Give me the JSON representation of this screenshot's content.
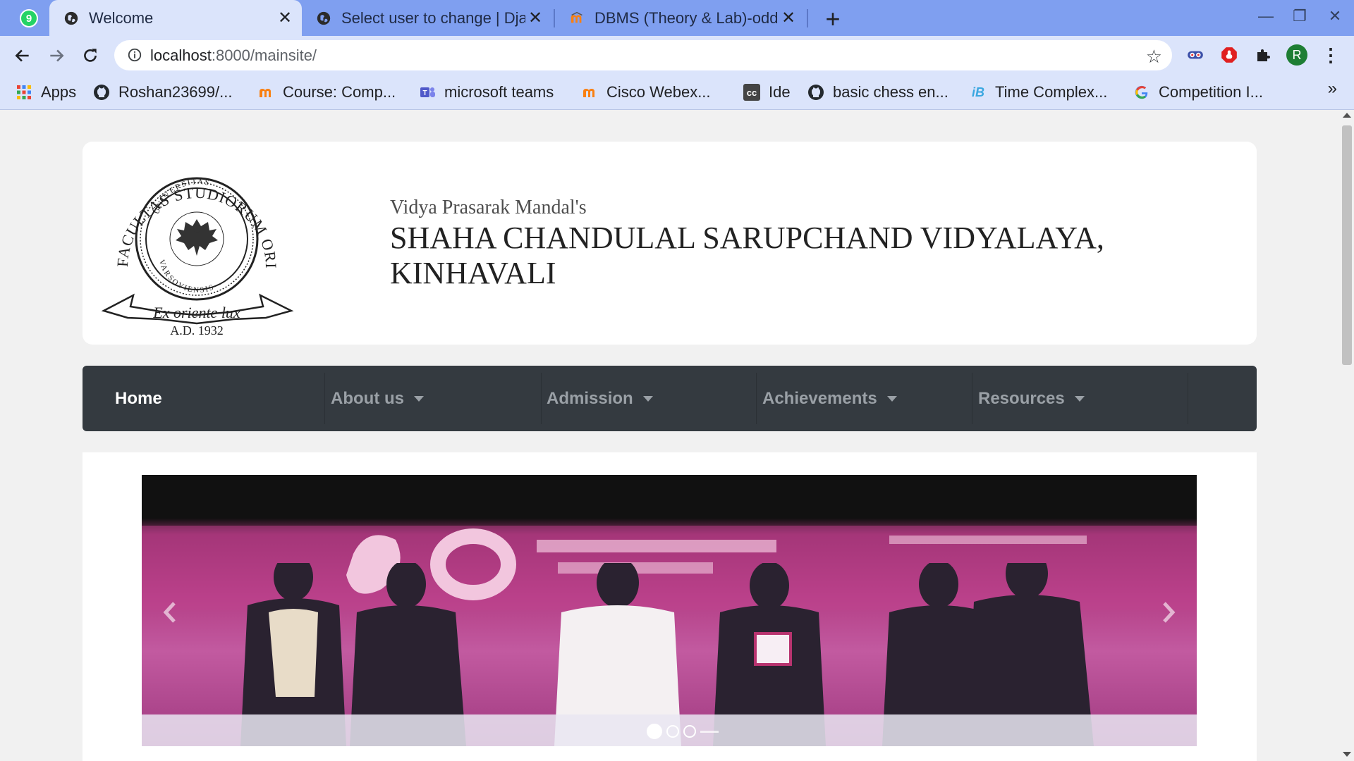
{
  "browser": {
    "tabs": [
      {
        "title": "Welcome",
        "active": true
      },
      {
        "title": "Select user to change | Dja",
        "active": false
      },
      {
        "title": "DBMS (Theory & Lab)-odd",
        "active": false
      }
    ],
    "whatsapp_badge": "9",
    "url_host": "localhost",
    "url_rest": ":8000/mainsite/",
    "profile_initial": "R",
    "bookmarks": [
      {
        "label": "Apps",
        "icon": "apps-grid-icon"
      },
      {
        "label": "Roshan23699/...",
        "icon": "github-icon"
      },
      {
        "label": "Course: Comp...",
        "icon": "moodle-icon"
      },
      {
        "label": "microsoft teams",
        "icon": "teams-icon"
      },
      {
        "label": "Cisco Webex...",
        "icon": "moodle-icon"
      },
      {
        "label": "Ide",
        "icon": "cc-icon"
      },
      {
        "label": "basic chess en...",
        "icon": "github-icon"
      },
      {
        "label": "Time Complex...",
        "icon": "ib-icon"
      },
      {
        "label": "Competition I...",
        "icon": "google-icon"
      }
    ],
    "more_bookmarks": "»"
  },
  "site": {
    "subtitle": "Vidya Prasarak Mandal's",
    "school_line1": "SHAHA CHANDULAL SARUPCHAND VIDYALAYA,",
    "school_line2": "KINHAVALI",
    "logo": {
      "arc_text": "FACULTAS STUDIORUM ORIENTALIUM",
      "inner_text": "UNIVERSITAS VARSOVIENSIS",
      "motto": "Ex oriente lux",
      "year": "A.D. 1932"
    },
    "nav": [
      {
        "label": "Home",
        "dropdown": false
      },
      {
        "label": "About us",
        "dropdown": true
      },
      {
        "label": "Admission",
        "dropdown": true
      },
      {
        "label": "Achievements",
        "dropdown": true
      },
      {
        "label": "Resources",
        "dropdown": true
      }
    ],
    "carousel": {
      "slide_count": 3,
      "active_index": 0
    }
  },
  "colors": {
    "tabstrip": "#7f9ff0",
    "toolbar": "#dbe4fb",
    "navbar": "#343a40",
    "page_bg": "#f1f1f1"
  }
}
